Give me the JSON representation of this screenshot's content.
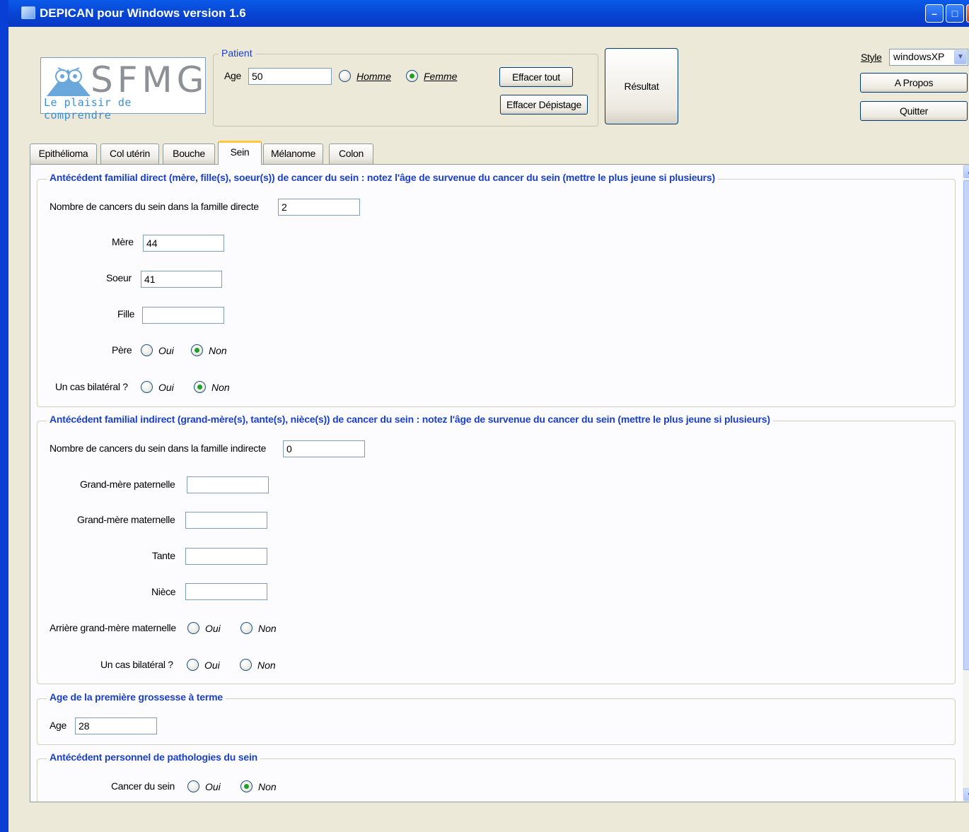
{
  "window": {
    "title": "DEPICAN pour Windows version 1.6"
  },
  "logo": {
    "brand": "SFMG",
    "tagline": "Le plaisir de comprendre"
  },
  "patient": {
    "legend": "Patient",
    "age_label": "Age",
    "age_value": "50",
    "sex_options": [
      "Homme",
      "Femme"
    ],
    "sex_selected": "Femme"
  },
  "buttons": {
    "effacer_tout": "Effacer tout",
    "effacer_depistage": "Effacer Dépistage",
    "resultat": "Résultat",
    "a_propos": "A Propos",
    "quitter": "Quitter"
  },
  "style": {
    "label": "Style",
    "value": "windowsXP"
  },
  "tabs": [
    "Epithélioma",
    "Col utérin",
    "Bouche",
    "Sein",
    "Mélanome",
    "Colon"
  ],
  "active_tab": "Sein",
  "sections": {
    "direct": {
      "legend": "Antécédent familial direct (mère, fille(s), soeur(s)) de cancer du sein : notez l'âge de survenue du cancer du sein (mettre le plus jeune si plusieurs)",
      "nombre_label": "Nombre de cancers du sein dans la famille directe",
      "nombre_value": "2",
      "mere_label": "Mère",
      "mere_value": "44",
      "soeur_label": "Soeur",
      "soeur_value": "41",
      "fille_label": "Fille",
      "fille_value": "",
      "pere_label": "Père",
      "pere_selected": "Non",
      "bilateral_label": "Un cas bilatéral ?",
      "bilateral_selected": "Non",
      "oui": "Oui",
      "non": "Non"
    },
    "indirect": {
      "legend": "Antécédent familial indirect (grand-mère(s), tante(s), nièce(s)) de cancer du sein : notez l'âge de survenue du cancer du sein (mettre le plus jeune si plusieurs)",
      "nombre_label": "Nombre de cancers du sein dans la famille indirecte",
      "nombre_value": "0",
      "gm_pat_label": "Grand-mère paternelle",
      "gm_mat_label": "Grand-mère maternelle",
      "tante_label": "Tante",
      "niece_label": "Nièce",
      "arriere_label": "Arrière grand-mère maternelle",
      "bilateral_label": "Un cas bilatéral ?",
      "oui": "Oui",
      "non": "Non"
    },
    "grossesse": {
      "legend": "Age de la première grossesse à terme",
      "age_label": "Age",
      "age_value": "28"
    },
    "personnel": {
      "legend": "Antécédent personnel de pathologies du sein",
      "cancer_label": "Cancer du sein",
      "cancer_selected": "Non",
      "oui": "Oui",
      "non": "Non"
    }
  }
}
